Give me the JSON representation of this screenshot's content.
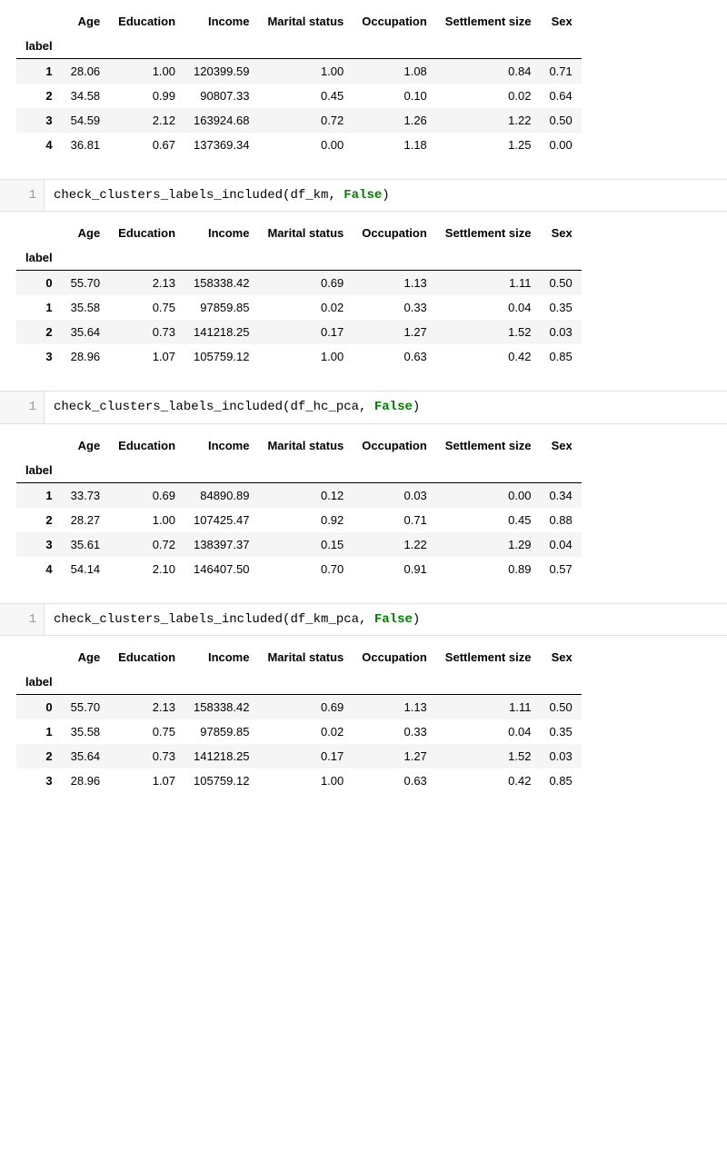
{
  "columns": [
    "Age",
    "Education",
    "Income",
    "Marital status",
    "Occupation",
    "Settlement size",
    "Sex"
  ],
  "index_label": "label",
  "tables": [
    {
      "id": "t1",
      "rows": [
        {
          "label": "1",
          "cells": [
            "28.06",
            "1.00",
            "120399.59",
            "1.00",
            "1.08",
            "0.84",
            "0.71"
          ]
        },
        {
          "label": "2",
          "cells": [
            "34.58",
            "0.99",
            "90807.33",
            "0.45",
            "0.10",
            "0.02",
            "0.64"
          ]
        },
        {
          "label": "3",
          "cells": [
            "54.59",
            "2.12",
            "163924.68",
            "0.72",
            "1.26",
            "1.22",
            "0.50"
          ]
        },
        {
          "label": "4",
          "cells": [
            "36.81",
            "0.67",
            "137369.34",
            "0.00",
            "1.18",
            "1.25",
            "0.00"
          ]
        }
      ]
    },
    {
      "id": "t2",
      "rows": [
        {
          "label": "0",
          "cells": [
            "55.70",
            "2.13",
            "158338.42",
            "0.69",
            "1.13",
            "1.11",
            "0.50"
          ]
        },
        {
          "label": "1",
          "cells": [
            "35.58",
            "0.75",
            "97859.85",
            "0.02",
            "0.33",
            "0.04",
            "0.35"
          ]
        },
        {
          "label": "2",
          "cells": [
            "35.64",
            "0.73",
            "141218.25",
            "0.17",
            "1.27",
            "1.52",
            "0.03"
          ]
        },
        {
          "label": "3",
          "cells": [
            "28.96",
            "1.07",
            "105759.12",
            "1.00",
            "0.63",
            "0.42",
            "0.85"
          ]
        }
      ]
    },
    {
      "id": "t3",
      "rows": [
        {
          "label": "1",
          "cells": [
            "33.73",
            "0.69",
            "84890.89",
            "0.12",
            "0.03",
            "0.00",
            "0.34"
          ]
        },
        {
          "label": "2",
          "cells": [
            "28.27",
            "1.00",
            "107425.47",
            "0.92",
            "0.71",
            "0.45",
            "0.88"
          ]
        },
        {
          "label": "3",
          "cells": [
            "35.61",
            "0.72",
            "138397.37",
            "0.15",
            "1.22",
            "1.29",
            "0.04"
          ]
        },
        {
          "label": "4",
          "cells": [
            "54.14",
            "2.10",
            "146407.50",
            "0.70",
            "0.91",
            "0.89",
            "0.57"
          ]
        }
      ]
    },
    {
      "id": "t4",
      "rows": [
        {
          "label": "0",
          "cells": [
            "55.70",
            "2.13",
            "158338.42",
            "0.69",
            "1.13",
            "1.11",
            "0.50"
          ]
        },
        {
          "label": "1",
          "cells": [
            "35.58",
            "0.75",
            "97859.85",
            "0.02",
            "0.33",
            "0.04",
            "0.35"
          ]
        },
        {
          "label": "2",
          "cells": [
            "35.64",
            "0.73",
            "141218.25",
            "0.17",
            "1.27",
            "1.52",
            "0.03"
          ]
        },
        {
          "label": "3",
          "cells": [
            "28.96",
            "1.07",
            "105759.12",
            "1.00",
            "0.63",
            "0.42",
            "0.85"
          ]
        }
      ]
    }
  ],
  "code_cells": [
    {
      "gutter": "1",
      "plain_prefix": "check_clusters_labels_included(df_km, ",
      "keyword": "False",
      "plain_suffix": ")"
    },
    {
      "gutter": "1",
      "plain_prefix": "check_clusters_labels_included(df_hc_pca, ",
      "keyword": "False",
      "plain_suffix": ")"
    },
    {
      "gutter": "1",
      "plain_prefix": "check_clusters_labels_included(df_km_pca, ",
      "keyword": "False",
      "plain_suffix": ")"
    }
  ],
  "chart_data": {
    "type": "table",
    "tables": [
      {
        "name": "cluster_means_1",
        "index_name": "label",
        "columns": [
          "Age",
          "Education",
          "Income",
          "Marital status",
          "Occupation",
          "Settlement size",
          "Sex"
        ],
        "index": [
          1,
          2,
          3,
          4
        ],
        "data": [
          [
            28.06,
            1.0,
            120399.59,
            1.0,
            1.08,
            0.84,
            0.71
          ],
          [
            34.58,
            0.99,
            90807.33,
            0.45,
            0.1,
            0.02,
            0.64
          ],
          [
            54.59,
            2.12,
            163924.68,
            0.72,
            1.26,
            1.22,
            0.5
          ],
          [
            36.81,
            0.67,
            137369.34,
            0.0,
            1.18,
            1.25,
            0.0
          ]
        ]
      },
      {
        "name": "cluster_means_df_km",
        "index_name": "label",
        "columns": [
          "Age",
          "Education",
          "Income",
          "Marital status",
          "Occupation",
          "Settlement size",
          "Sex"
        ],
        "index": [
          0,
          1,
          2,
          3
        ],
        "data": [
          [
            55.7,
            2.13,
            158338.42,
            0.69,
            1.13,
            1.11,
            0.5
          ],
          [
            35.58,
            0.75,
            97859.85,
            0.02,
            0.33,
            0.04,
            0.35
          ],
          [
            35.64,
            0.73,
            141218.25,
            0.17,
            1.27,
            1.52,
            0.03
          ],
          [
            28.96,
            1.07,
            105759.12,
            1.0,
            0.63,
            0.42,
            0.85
          ]
        ]
      },
      {
        "name": "cluster_means_df_hc_pca",
        "index_name": "label",
        "columns": [
          "Age",
          "Education",
          "Income",
          "Marital status",
          "Occupation",
          "Settlement size",
          "Sex"
        ],
        "index": [
          1,
          2,
          3,
          4
        ],
        "data": [
          [
            33.73,
            0.69,
            84890.89,
            0.12,
            0.03,
            0.0,
            0.34
          ],
          [
            28.27,
            1.0,
            107425.47,
            0.92,
            0.71,
            0.45,
            0.88
          ],
          [
            35.61,
            0.72,
            138397.37,
            0.15,
            1.22,
            1.29,
            0.04
          ],
          [
            54.14,
            2.1,
            146407.5,
            0.7,
            0.91,
            0.89,
            0.57
          ]
        ]
      },
      {
        "name": "cluster_means_df_km_pca",
        "index_name": "label",
        "columns": [
          "Age",
          "Education",
          "Income",
          "Marital status",
          "Occupation",
          "Settlement size",
          "Sex"
        ],
        "index": [
          0,
          1,
          2,
          3
        ],
        "data": [
          [
            55.7,
            2.13,
            158338.42,
            0.69,
            1.13,
            1.11,
            0.5
          ],
          [
            35.58,
            0.75,
            97859.85,
            0.02,
            0.33,
            0.04,
            0.35
          ],
          [
            35.64,
            0.73,
            141218.25,
            0.17,
            1.27,
            1.52,
            0.03
          ],
          [
            28.96,
            1.07,
            105759.12,
            1.0,
            0.63,
            0.42,
            0.85
          ]
        ]
      }
    ]
  }
}
